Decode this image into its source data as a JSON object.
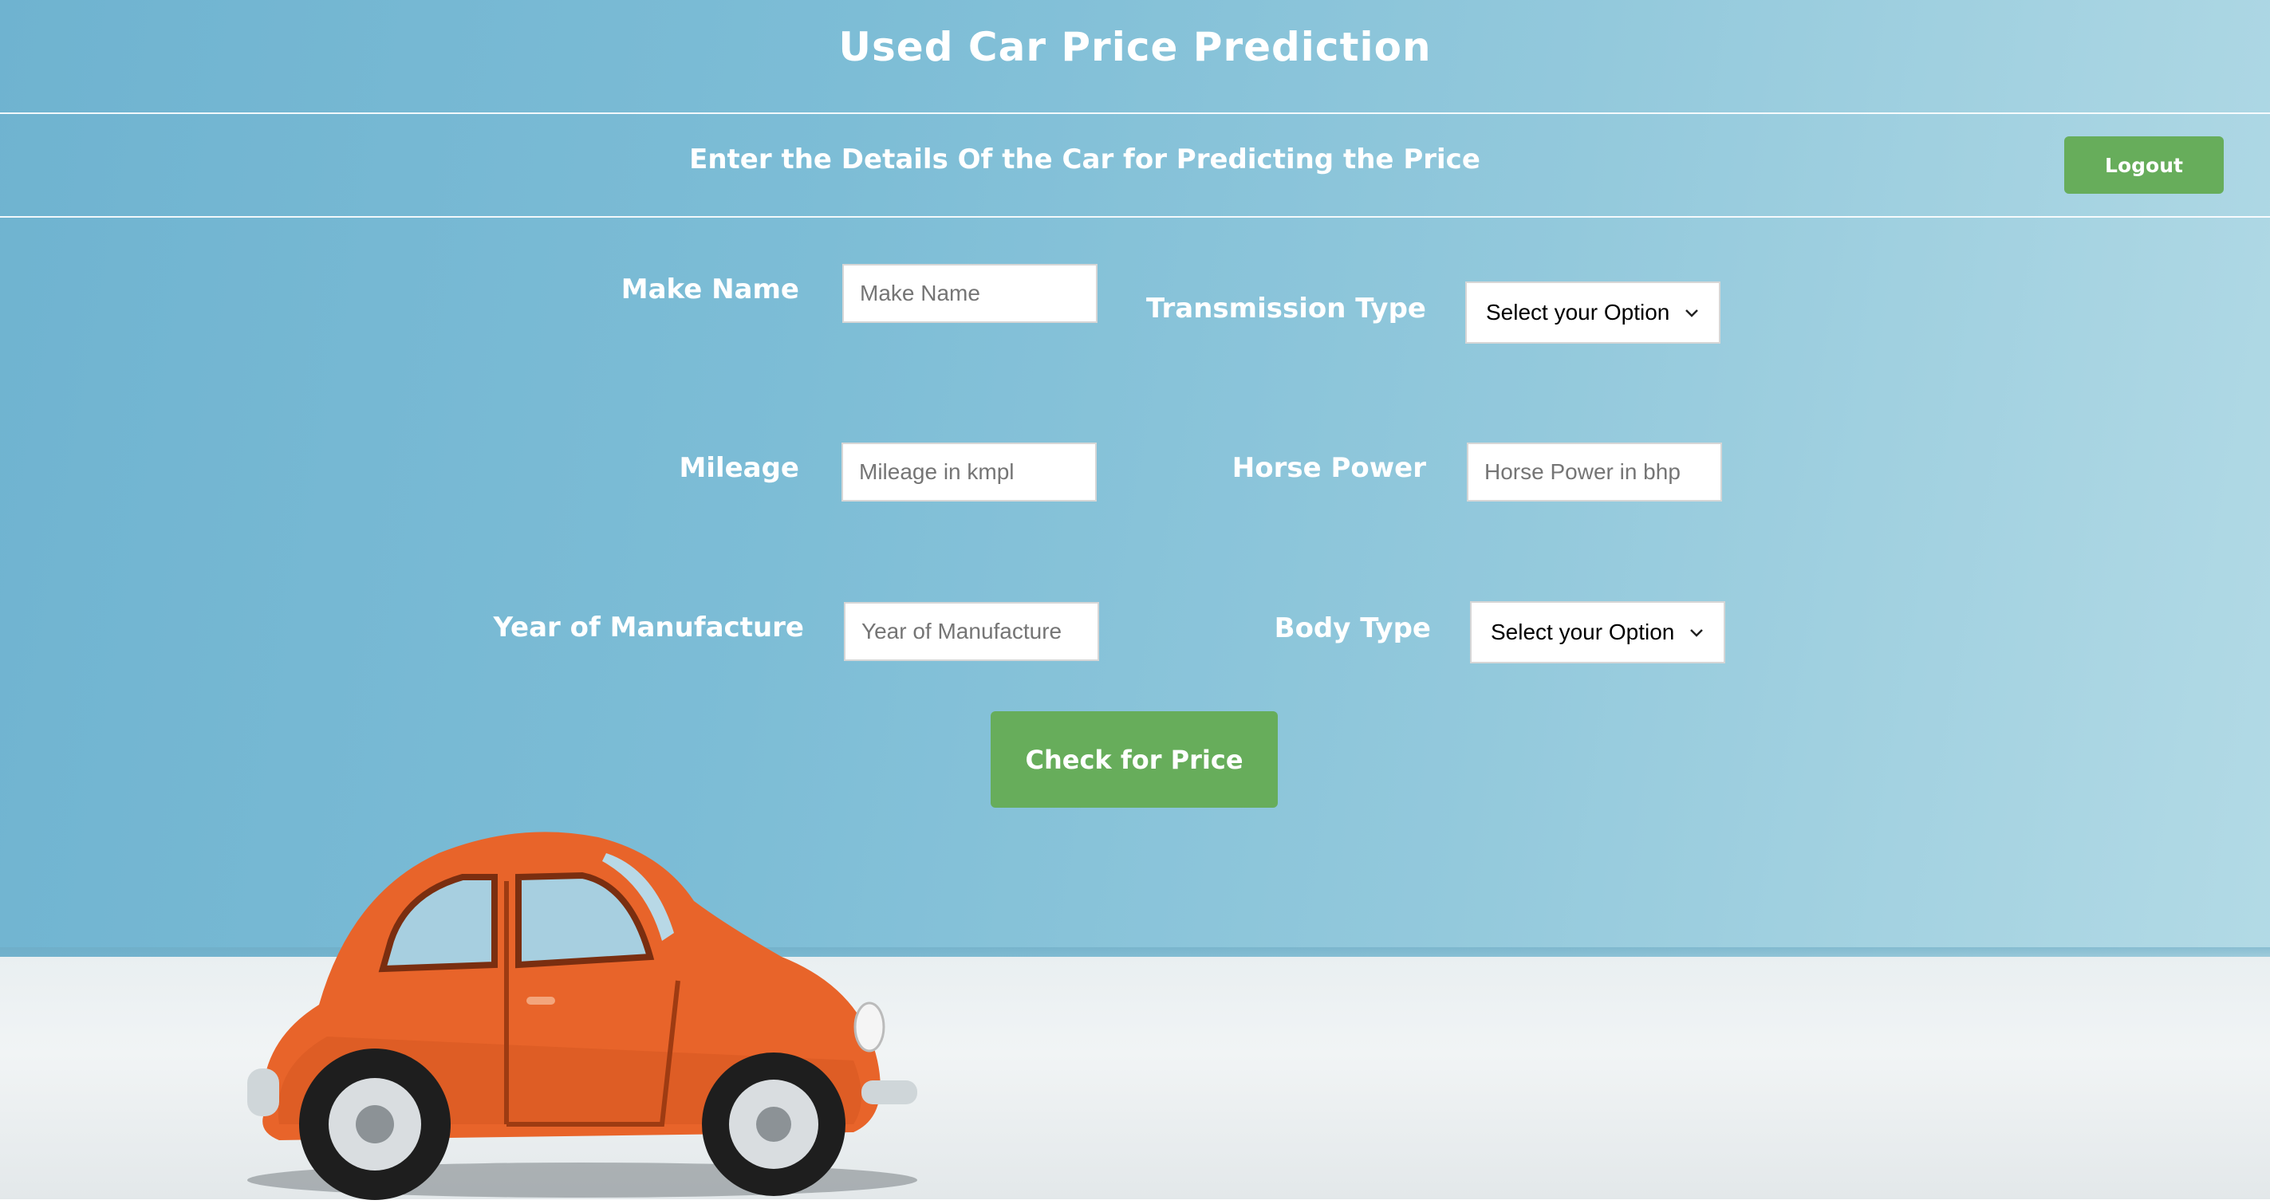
{
  "header": {
    "title": "Used Car Price Prediction",
    "subtitle": "Enter the Details Of the Car for Predicting the Price",
    "logout_label": "Logout"
  },
  "form": {
    "make_name": {
      "label": "Make Name",
      "placeholder": "Make Name",
      "value": ""
    },
    "transmission_type": {
      "label": "Transmission Type",
      "selected": "Select your Option"
    },
    "mileage": {
      "label": "Mileage",
      "placeholder": "Mileage in kmpl",
      "value": ""
    },
    "horse_power": {
      "label": "Horse Power",
      "placeholder": "Horse Power in bhp",
      "value": ""
    },
    "year_of_manufacture": {
      "label": "Year of Manufacture",
      "placeholder": "Year of Manufacture",
      "value": ""
    },
    "body_type": {
      "label": "Body Type",
      "selected": "Select your Option"
    },
    "submit_label": "Check for Price"
  },
  "colors": {
    "button_green": "#67ad5b",
    "sky_blue": "#7dbdd6",
    "car_orange": "#e8642a"
  },
  "icons": {
    "select_arrow": "chevron-down-icon",
    "background_image": "orange-toy-car-image"
  }
}
